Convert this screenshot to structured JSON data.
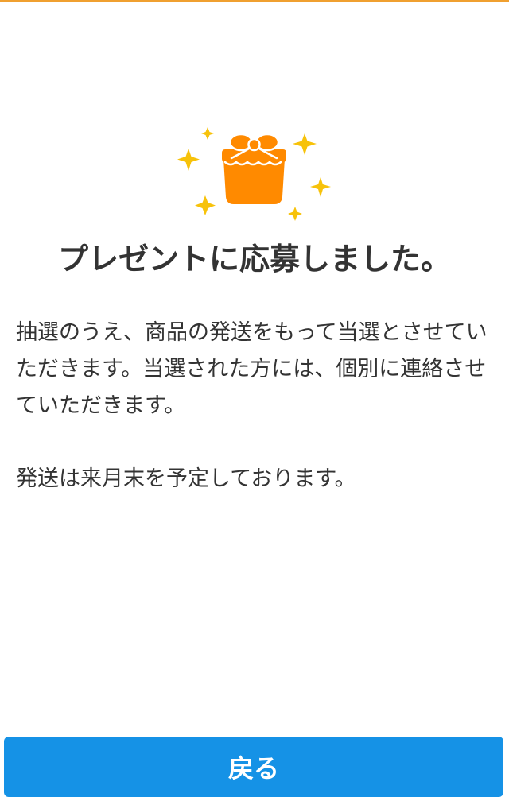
{
  "header": {
    "accent_color": "#f0a030"
  },
  "hero": {
    "icon": "gift-box-with-sparkles-icon",
    "gift_color": "#ff8a00",
    "sparkle_color": "#f7c20a"
  },
  "headline": "プレゼントに応募しました。",
  "body": {
    "paragraph_1": "抽選のうえ、商品の発送をもって当選とさせていただきます。当選された方には、個別に連絡させていただきます。",
    "paragraph_2": "発送は来月末を予定しております。"
  },
  "footer": {
    "back_label": "戻る",
    "button_color": "#1592e6"
  }
}
